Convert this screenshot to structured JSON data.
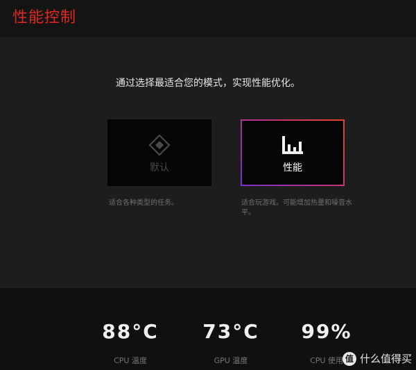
{
  "header": {
    "title": "性能控制"
  },
  "main": {
    "subtitle": "通过选择最适合您的模式，实现性能优化。",
    "modes": [
      {
        "id": "default",
        "label": "默认",
        "icon": "diamond-icon",
        "description": "适合各种类型的任务。",
        "selected": false
      },
      {
        "id": "performance",
        "label": "性能",
        "icon": "bar-levels-icon",
        "description": "适合玩游戏。可能增加热量和噪音水平。",
        "selected": true
      }
    ]
  },
  "stats": [
    {
      "value": "88°C",
      "label": "CPU 温度"
    },
    {
      "value": "73°C",
      "label": "GPU 温度"
    },
    {
      "value": "99%",
      "label": "CPU 使用"
    }
  ],
  "watermark": {
    "badge": "值",
    "text": "什么值得买"
  },
  "colors": {
    "title": "#e0281f",
    "accent_start": "#7b2fd0",
    "accent_end": "#e8422a"
  }
}
